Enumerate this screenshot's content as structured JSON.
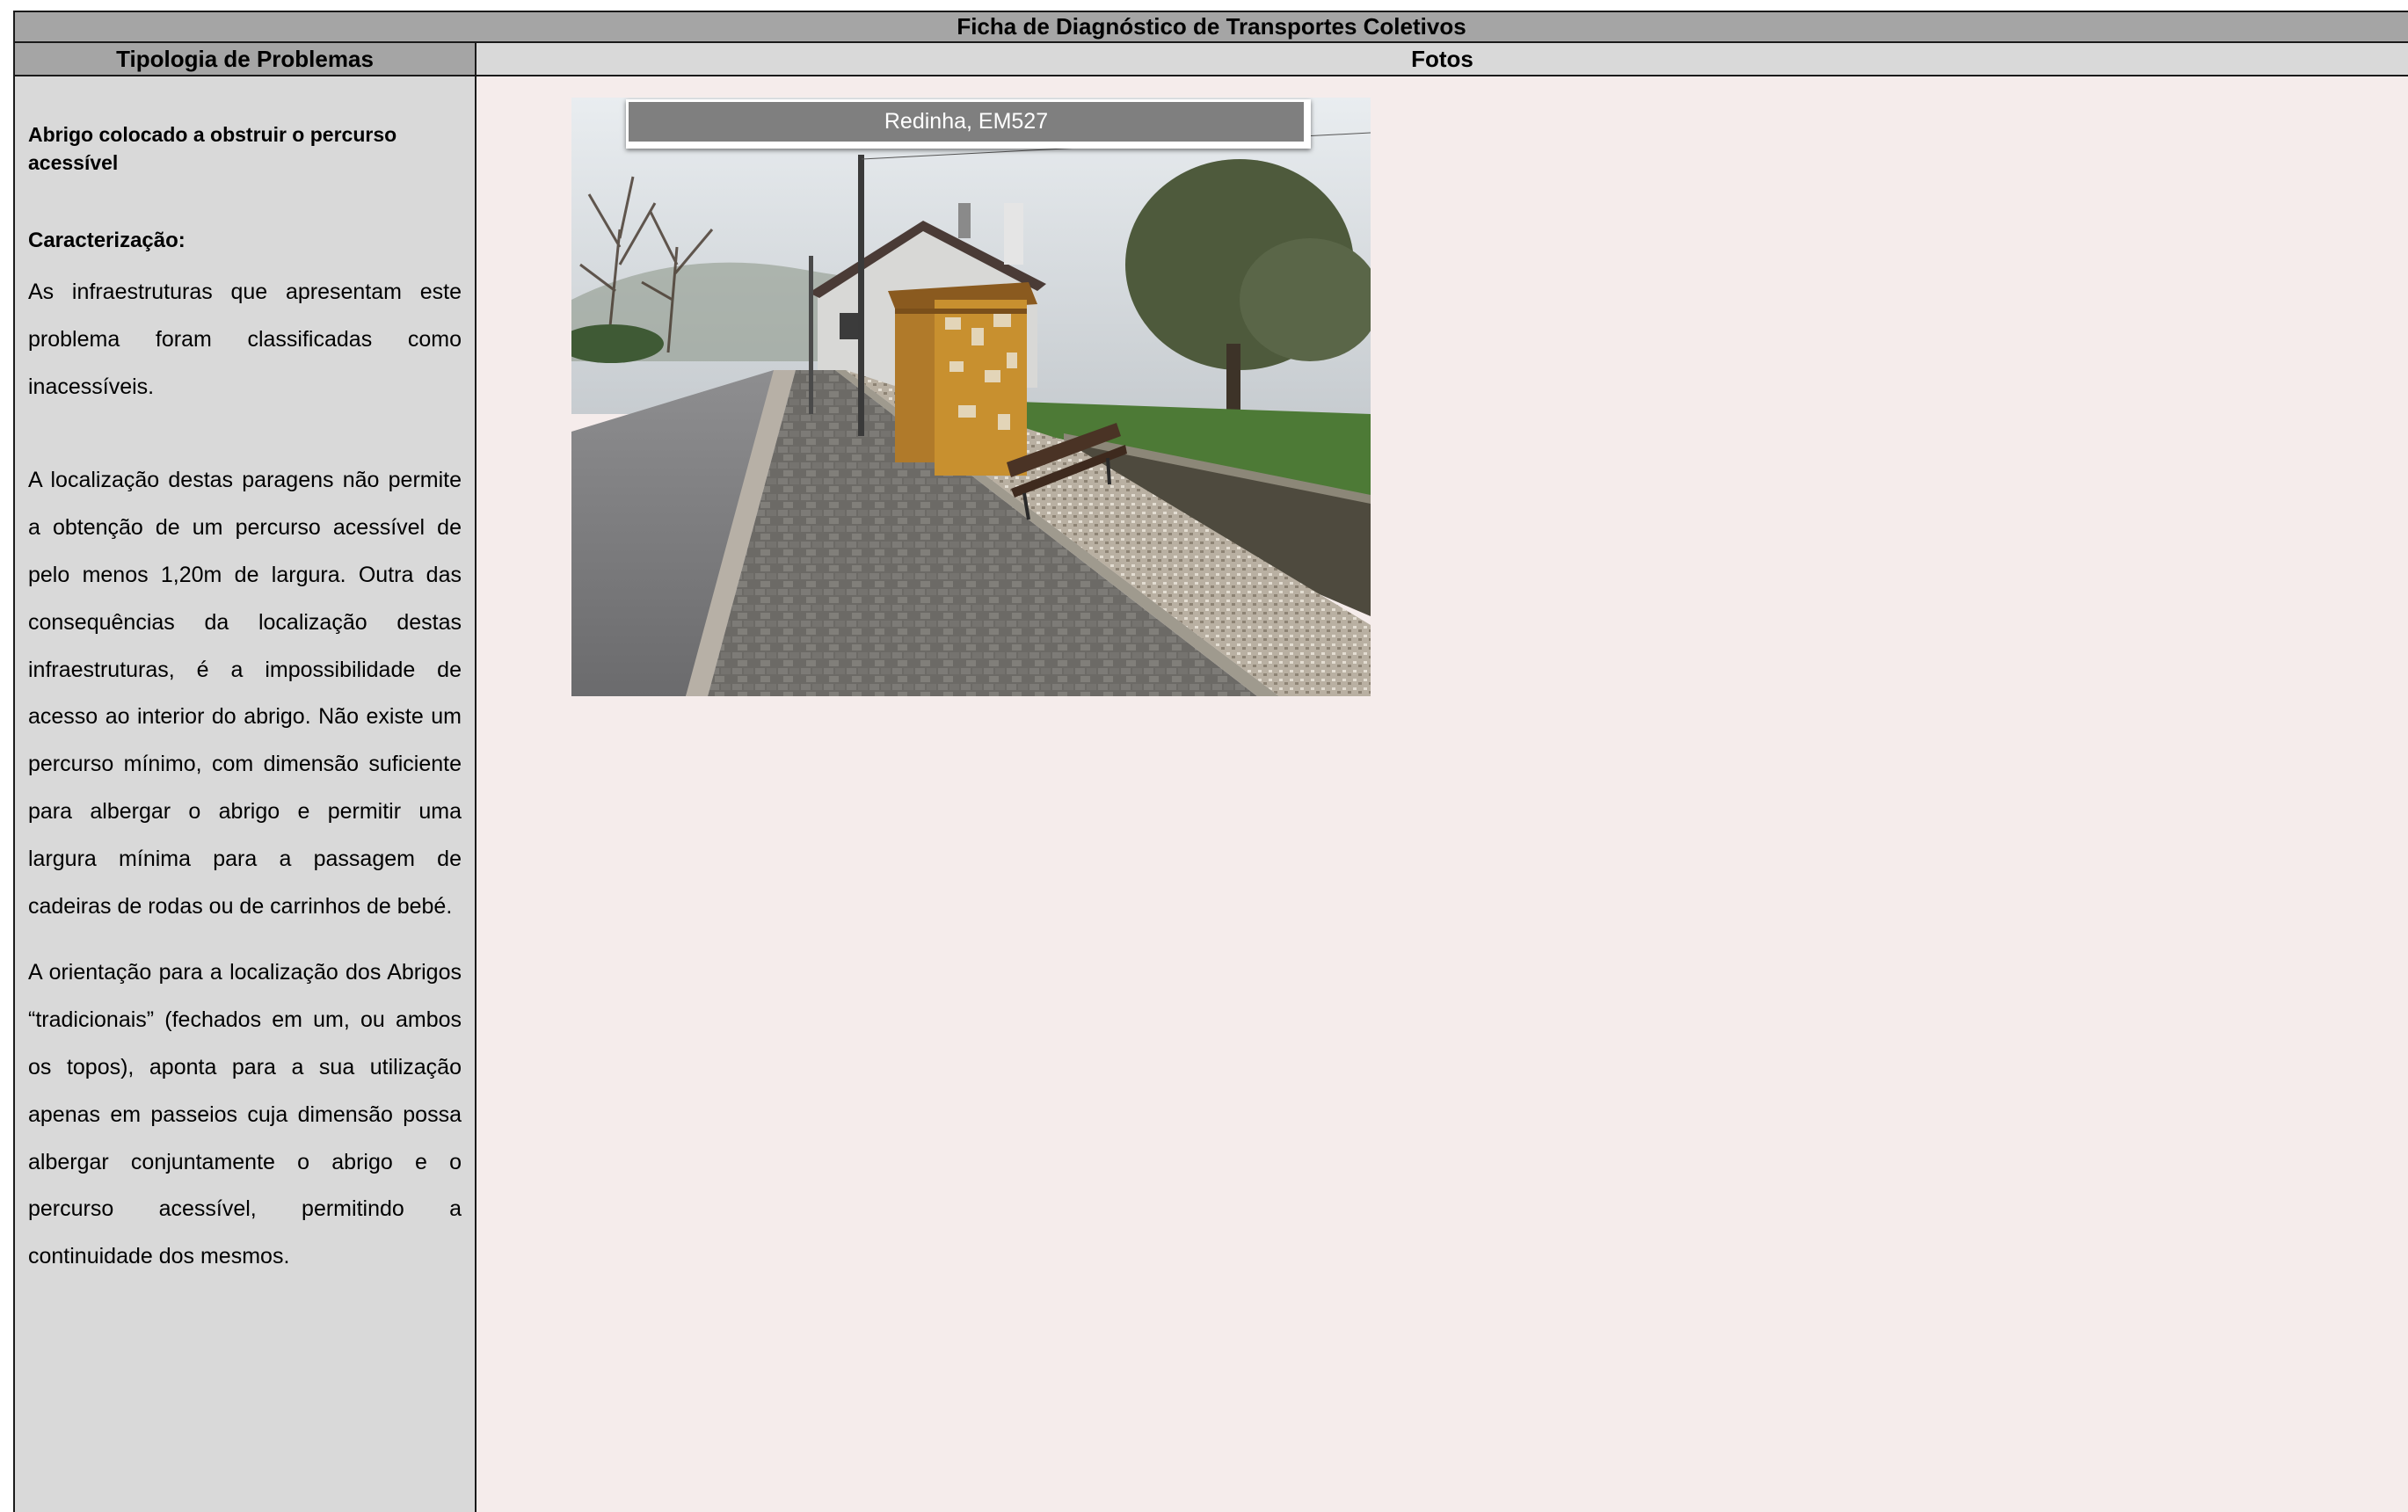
{
  "sheet": {
    "title": "Ficha de Diagnóstico de Transportes Coletivos",
    "left_header": "Tipologia de Problemas",
    "right_header": "Fotos"
  },
  "problem": {
    "title": "Abrigo colocado a obstruir o percurso acessível",
    "characterization_label": "Caracterização:",
    "paragraphs": [
      "As infraestruturas que apresentam este problema foram classificadas como inacessíveis.",
      "A localização destas paragens não permite a obtenção de um percurso acessível de pelo menos 1,20m de largura. Outra das consequências da localização destas infraestruturas, é a impossibilidade de acesso ao interior do abrigo. Não existe um percurso mínimo, com dimensão suficiente para albergar o abrigo e permitir  uma largura mínima para a passagem de cadeiras de rodas ou de carrinhos de bebé.",
      "A orientação para a localização dos Abrigos “tradicionais” (fechados em um, ou ambos os topos), aponta para a sua utilização apenas em passeios cuja dimensão possa albergar conjuntamente o abrigo e o percurso acessível, permitindo a continuidade dos mesmos."
    ]
  },
  "photo": {
    "caption": "Redinha, EM527"
  },
  "colors": {
    "header_dark": "#a5a5a5",
    "header_light": "#d9d9d9",
    "left_panel": "#d9d9d9",
    "right_panel": "#f5eceb",
    "caption_bg": "#7f7f7f"
  }
}
